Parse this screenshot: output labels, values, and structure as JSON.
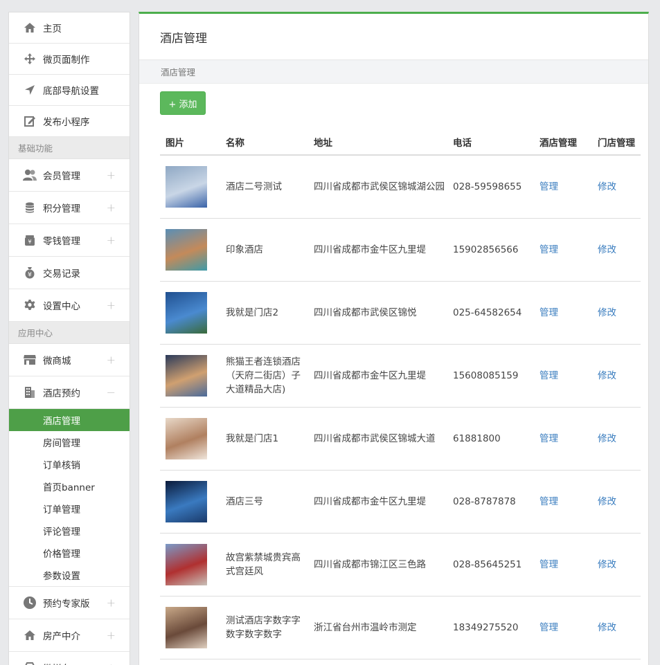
{
  "sidebar": {
    "top_items": [
      {
        "label": "主页",
        "icon": "home-icon"
      },
      {
        "label": "微页面制作",
        "icon": "move-icon"
      },
      {
        "label": "底部导航设置",
        "icon": "navigation-icon"
      },
      {
        "label": "发布小程序",
        "icon": "edit-icon"
      }
    ],
    "section_basic": "基础功能",
    "basic_items": [
      {
        "label": "会员管理",
        "icon": "users-icon"
      },
      {
        "label": "积分管理",
        "icon": "coins-icon"
      },
      {
        "label": "零钱管理",
        "icon": "wallet-icon"
      },
      {
        "label": "交易记录",
        "icon": "money-bag-icon"
      },
      {
        "label": "设置中心",
        "icon": "gear-icon"
      }
    ],
    "section_apps": "应用中心",
    "app_items": [
      {
        "label": "微商城",
        "icon": "store-icon"
      },
      {
        "label": "酒店预约",
        "icon": "building-icon"
      }
    ],
    "hotel_subitems": [
      "酒店管理",
      "房间管理",
      "订单核销",
      "首页banner",
      "订单管理",
      "评论管理",
      "价格管理",
      "参数设置"
    ],
    "bottom_items": [
      {
        "label": "预约专家版",
        "icon": "clock-icon"
      },
      {
        "label": "房产中介",
        "icon": "home-icon"
      },
      {
        "label": "微拼车",
        "icon": "car-icon"
      }
    ]
  },
  "main": {
    "title": "酒店管理",
    "breadcrumb": "酒店管理",
    "add_button": "+ 添加",
    "columns": [
      "图片",
      "名称",
      "地址",
      "电话",
      "酒店管理",
      "门店管理"
    ],
    "rows": [
      {
        "name": "酒店二号测试",
        "address": "四川省成都市武侯区锦城湖公园",
        "phone": "028-59598655",
        "manage": "管理",
        "edit": "修改",
        "thumb_colors": [
          "#8fa8c4",
          "#c9d6e6",
          "#3a63a8"
        ]
      },
      {
        "name": "印象酒店",
        "address": "四川省成都市金牛区九里堤",
        "phone": "15902856566",
        "manage": "管理",
        "edit": "修改",
        "thumb_colors": [
          "#5a8fb6",
          "#c48a5a",
          "#3e9aa8"
        ]
      },
      {
        "name": "我就是门店2",
        "address": "四川省成都市武侯区锦悦",
        "phone": "025-64582654",
        "manage": "管理",
        "edit": "修改",
        "thumb_colors": [
          "#1f4f8f",
          "#4a8ad0",
          "#3a6a3a"
        ]
      },
      {
        "name": "熊猫王者连锁酒店（天府二街店）子大道精品大店)",
        "address": "四川省成都市金牛区九里堤",
        "phone": "15608085159",
        "manage": "管理",
        "edit": "修改",
        "thumb_colors": [
          "#2a3a5a",
          "#d0a070",
          "#4a6a9a"
        ]
      },
      {
        "name": "我就是门店1",
        "address": "四川省成都市武侯区锦城大道",
        "phone": "61881800",
        "manage": "管理",
        "edit": "修改",
        "thumb_colors": [
          "#e8d8c8",
          "#b08060",
          "#f0e6dc"
        ]
      },
      {
        "name": "酒店三号",
        "address": "四川省成都市金牛区九里堤",
        "phone": "028-8787878",
        "manage": "管理",
        "edit": "修改",
        "thumb_colors": [
          "#0a1a3a",
          "#3a7ac0",
          "#1a3a6a"
        ]
      },
      {
        "name": "故宫紫禁城贵宾高式宫廷风",
        "address": "四川省成都市锦江区三色路",
        "phone": "028-85645251",
        "manage": "管理",
        "edit": "修改",
        "thumb_colors": [
          "#7a9ac8",
          "#b03030",
          "#c8c0b8"
        ]
      },
      {
        "name": "测试酒店字数字字数字数字数字",
        "address": "浙江省台州市温岭市测定",
        "phone": "18349275520",
        "manage": "管理",
        "edit": "修改",
        "thumb_colors": [
          "#c8a888",
          "#6a4a3a",
          "#e0d0c0"
        ]
      }
    ]
  }
}
